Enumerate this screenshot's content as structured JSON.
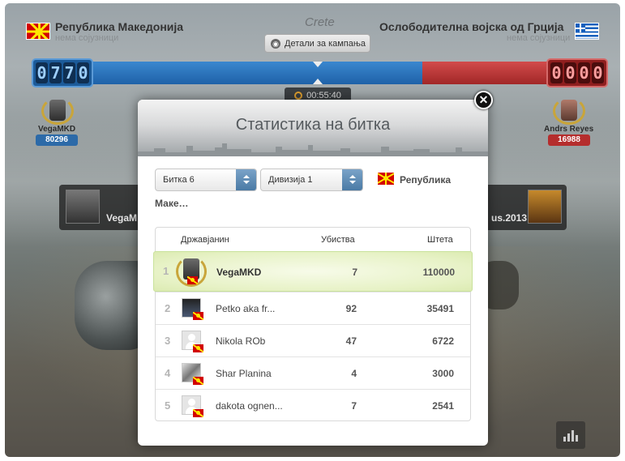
{
  "header": {
    "left_country": "Република Македонија",
    "left_allies": "нема сојузници",
    "right_country": "Ослободителна војска од Грција",
    "right_allies": "нема сојузници",
    "region": "Crete",
    "campaign_button": "Детали за кампања",
    "left_score_digits": [
      "0",
      "7",
      "7",
      "0"
    ],
    "right_score_digits": [
      "0",
      "0",
      "0",
      "0"
    ],
    "timer": "00:55:40"
  },
  "heroes": {
    "left": {
      "name": "VegaMKD",
      "damage": "80296"
    },
    "right": {
      "name": "Andrs Reyes",
      "damage": "16988"
    }
  },
  "side_panels": {
    "left_name": "VegaM",
    "right_name": "us.2013"
  },
  "modal": {
    "title": "Статистика на битка",
    "battle_select": "Битка 6",
    "division_select": "Дивизија 1",
    "country_filter_line1": "Република",
    "country_filter_line2": "Маке…",
    "columns": {
      "citizen": "Државјанин",
      "kills": "Убиства",
      "damage": "Штета"
    },
    "rows": [
      {
        "rank": "1",
        "name": "VegaMKD",
        "kills": "7",
        "damage": "110000"
      },
      {
        "rank": "2",
        "name": "Petko aka fr...",
        "kills": "92",
        "damage": "35491"
      },
      {
        "rank": "3",
        "name": "Nikola ROb",
        "kills": "47",
        "damage": "6722"
      },
      {
        "rank": "4",
        "name": "Shar Planina",
        "kills": "4",
        "damage": "3000"
      },
      {
        "rank": "5",
        "name": "dakota ognen...",
        "kills": "7",
        "damage": "2541"
      }
    ]
  },
  "colors": {
    "blue_bar": "#2a6fb6",
    "red_bar": "#b83434",
    "highlight_row": "#e7f2c6"
  },
  "icons": [
    "globe-icon",
    "clock-icon",
    "close-icon",
    "chart-icon",
    "macedonia-flag-icon",
    "greece-flag-icon",
    "dropdown-arrow-icon"
  ]
}
